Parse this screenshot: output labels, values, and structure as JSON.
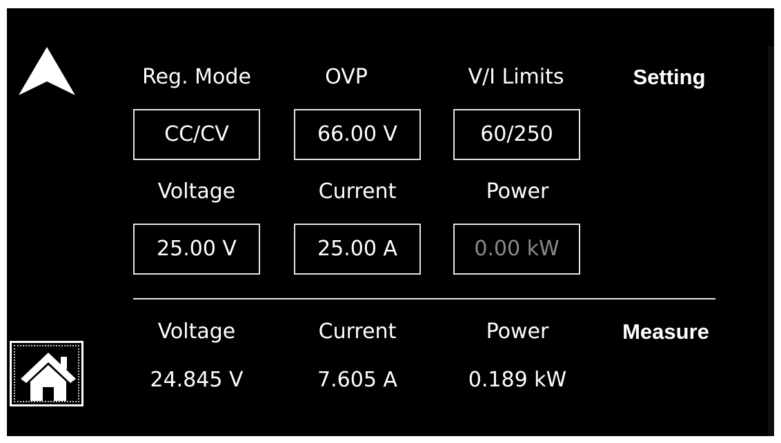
{
  "setting": {
    "section_label": "Setting",
    "labels": {
      "reg_mode": "Reg. Mode",
      "ovp": "OVP",
      "vi_limits": "V/I Limits",
      "voltage": "Voltage",
      "current": "Current",
      "power": "Power"
    },
    "values": {
      "reg_mode": "CC/CV",
      "ovp": "66.00 V",
      "vi_limits": "60/250",
      "voltage": "25.00 V",
      "current": "25.00 A",
      "power": "0.00 kW"
    }
  },
  "measure": {
    "section_label": "Measure",
    "labels": {
      "voltage": "Voltage",
      "current": "Current",
      "power": "Power"
    },
    "values": {
      "voltage": "24.845 V",
      "current": "7.605 A",
      "power": "0.189 kW"
    }
  },
  "nav": {
    "up_icon": "up-arrow-icon",
    "home_icon": "home-icon"
  },
  "colors": {
    "background": "#000000",
    "foreground": "#ffffff",
    "disabled_text": "#8a8a8a"
  }
}
